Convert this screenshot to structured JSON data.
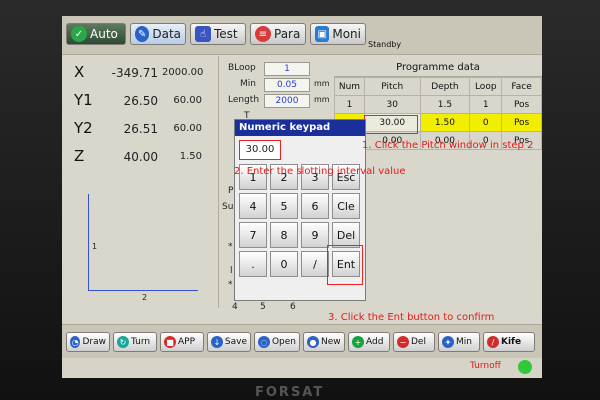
{
  "tabs": [
    {
      "label": "Auto",
      "icon": "check-icon"
    },
    {
      "label": "Data",
      "icon": "pencil-icon"
    },
    {
      "label": "Test",
      "icon": "hand-icon"
    },
    {
      "label": "Para",
      "icon": "gauge-icon"
    },
    {
      "label": "Moni",
      "icon": "monitor-icon"
    }
  ],
  "status_text": "Standby",
  "axes": [
    {
      "name": "X",
      "pos": "-349.71",
      "speed": "2000.00"
    },
    {
      "name": "Y1",
      "pos": "26.50",
      "speed": "60.00"
    },
    {
      "name": "Y2",
      "pos": "26.51",
      "speed": "60.00"
    },
    {
      "name": "Z",
      "pos": "40.00",
      "speed": "1.50"
    }
  ],
  "plot": {
    "y_label": "1",
    "x_label": "2"
  },
  "params": {
    "bloop": {
      "label": "BLoop",
      "value": "1"
    },
    "min": {
      "label": "Min",
      "value": "0.05",
      "unit": "mm"
    },
    "length": {
      "label": "Length",
      "value": "2000",
      "unit": "mm"
    },
    "t_label": "T"
  },
  "hidden_labels": {
    "p": "P",
    "su": "Su",
    "star": "*",
    "l": "l",
    "star2": "*",
    "r4": "4",
    "r5": "5",
    "r6": "6"
  },
  "programme": {
    "title": "Programme data",
    "headers": [
      "Num",
      "Pitch",
      "Depth",
      "Loop",
      "Face"
    ],
    "rows": [
      [
        "1",
        "30",
        "1.5",
        "1",
        "Pos"
      ],
      [
        "",
        "30.00",
        "1.50",
        "0",
        "Pos"
      ],
      [
        "",
        "0.00",
        "0.00",
        "0",
        "Pos"
      ]
    ]
  },
  "keypad": {
    "title": "Numeric keypad",
    "display": "30.00",
    "keys": [
      [
        "1",
        "2",
        "3",
        "Esc"
      ],
      [
        "4",
        "5",
        "6",
        "Cle"
      ],
      [
        "7",
        "8",
        "9",
        "Del"
      ],
      [
        ".",
        "0",
        "/",
        "Ent"
      ]
    ]
  },
  "instructions": {
    "step1": "1. Click the Pitch window in step 2",
    "step2": "2. Enter the slotting interval value",
    "step3": "3. Click the Ent button to confirm"
  },
  "bottom_buttons": [
    {
      "label": "Draw",
      "icon": "draw-icon",
      "color": "#2b62c8"
    },
    {
      "label": "Turn",
      "icon": "turn-icon",
      "color": "#1aa89b"
    },
    {
      "label": "APP",
      "icon": "app-icon",
      "color": "#d32c2c"
    },
    {
      "label": "Save",
      "icon": "save-icon",
      "color": "#2b62c8"
    },
    {
      "label": "Open",
      "icon": "open-icon",
      "color": "#2b62c8"
    },
    {
      "label": "New",
      "icon": "new-icon",
      "color": "#2b62c8"
    },
    {
      "label": "Add",
      "icon": "add-icon",
      "color": "#19a13b"
    },
    {
      "label": "Del",
      "icon": "delete-icon",
      "color": "#d32c2c"
    },
    {
      "label": "Min",
      "icon": "min-icon",
      "color": "#2b62c8"
    },
    {
      "label": "Kife",
      "icon": "knife-icon",
      "color": "#d32c2c"
    }
  ],
  "footer": {
    "turnoff": "Turnoff"
  },
  "brand": "FORSAT",
  "colors": {
    "accent": "#1b2f9b",
    "highlight": "#f2ee00",
    "annotation": "#e21b1b",
    "led": "#31c83a"
  }
}
